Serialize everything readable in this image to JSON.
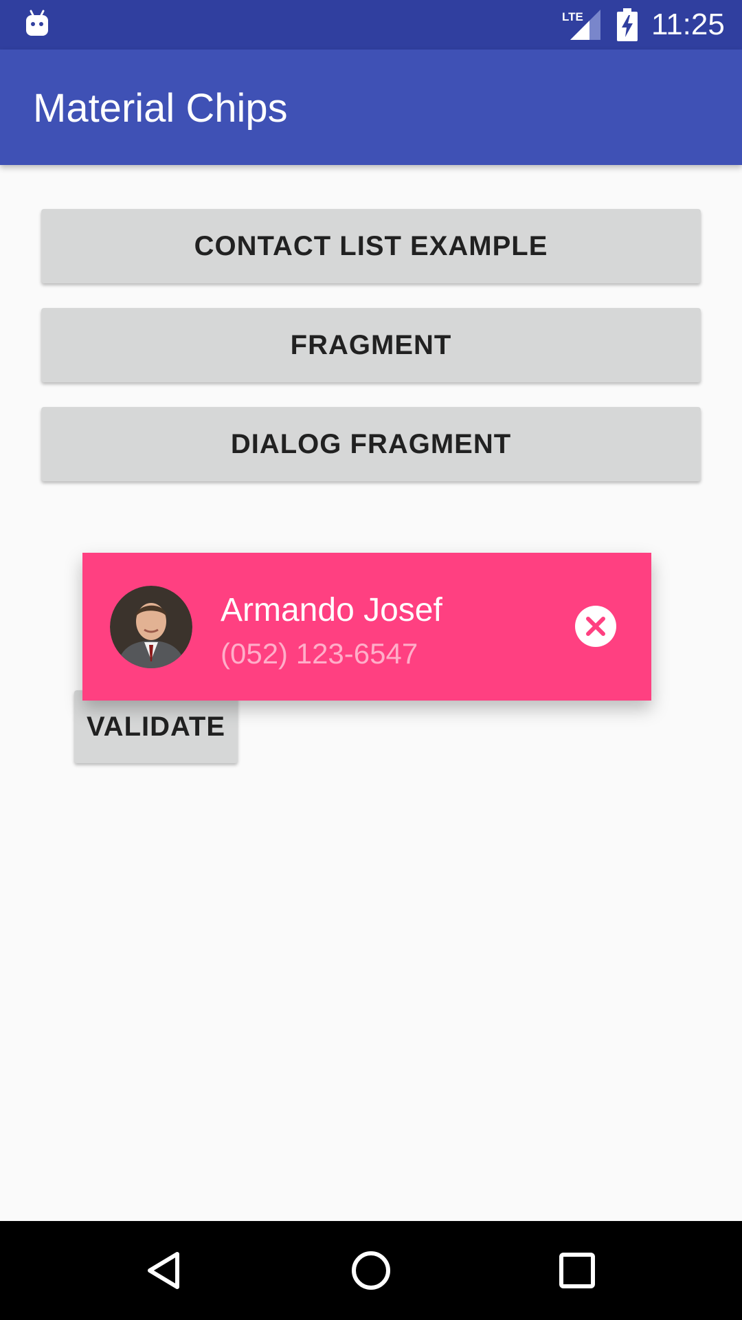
{
  "status_bar": {
    "time": "11:25",
    "network_label": "LTE",
    "icons": [
      "android-notification-icon",
      "lte-signal-icon",
      "battery-charging-icon"
    ]
  },
  "app_bar": {
    "title": "Material Chips"
  },
  "buttons": {
    "contact_list": "CONTACT LIST EXAMPLE",
    "fragment": "FRAGMENT",
    "dialog_fragment": "DIALOG FRAGMENT",
    "validate": "VALIDATE"
  },
  "chip_details": {
    "name": "Armando Josef",
    "phone": "(052) 123-6547",
    "icons": [
      "contact-avatar",
      "close-icon"
    ]
  },
  "nav_bar": {
    "icons": [
      "back-icon",
      "home-icon",
      "recents-icon"
    ]
  },
  "colors": {
    "status_bar": "#303f9f",
    "primary": "#3f51b5",
    "accent": "#ff4081",
    "button": "#d6d7d7",
    "background": "#fafafa"
  }
}
